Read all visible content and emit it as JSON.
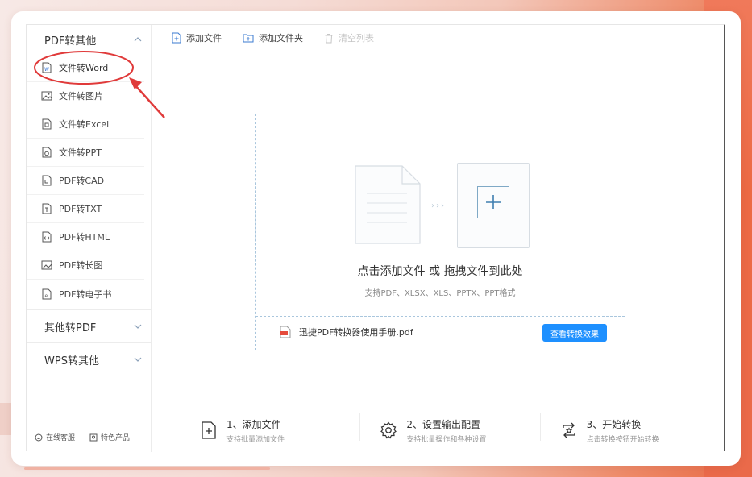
{
  "sidebar": {
    "group1": "PDF转其他",
    "items": [
      {
        "label": "文件转Word",
        "icon": "word-doc-icon"
      },
      {
        "label": "文件转图片",
        "icon": "image-icon"
      },
      {
        "label": "文件转Excel",
        "icon": "excel-doc-icon"
      },
      {
        "label": "文件转PPT",
        "icon": "ppt-doc-icon"
      },
      {
        "label": "PDF转CAD",
        "icon": "cad-doc-icon"
      },
      {
        "label": "PDF转TXT",
        "icon": "txt-doc-icon"
      },
      {
        "label": "PDF转HTML",
        "icon": "html-doc-icon"
      },
      {
        "label": "PDF转长图",
        "icon": "long-image-icon"
      },
      {
        "label": "PDF转电子书",
        "icon": "ebook-doc-icon"
      }
    ],
    "group2": "其他转PDF",
    "group3": "WPS转其他",
    "support": "在线客服",
    "featured": "特色产品"
  },
  "toolbar": {
    "add_file": "添加文件",
    "add_folder": "添加文件夹",
    "clear_list": "清空列表"
  },
  "dropzone": {
    "main_text": "点击添加文件 或 拖拽文件到此处",
    "sub_text": "支持PDF、XLSX、XLS、PPTX、PPT格式",
    "file_name": "迅捷PDF转换器使用手册.pdf",
    "view_button": "查看转换效果",
    "arrows": "›››"
  },
  "steps": [
    {
      "title": "1、添加文件",
      "desc": "支持批量添加文件"
    },
    {
      "title": "2、设置输出配置",
      "desc": "支持批量操作和各种设置"
    },
    {
      "title": "3、开始转换",
      "desc": "点击转换按钮开始转换"
    }
  ],
  "colors": {
    "accent": "#1e90ff",
    "annotation": "#e03a3a"
  }
}
